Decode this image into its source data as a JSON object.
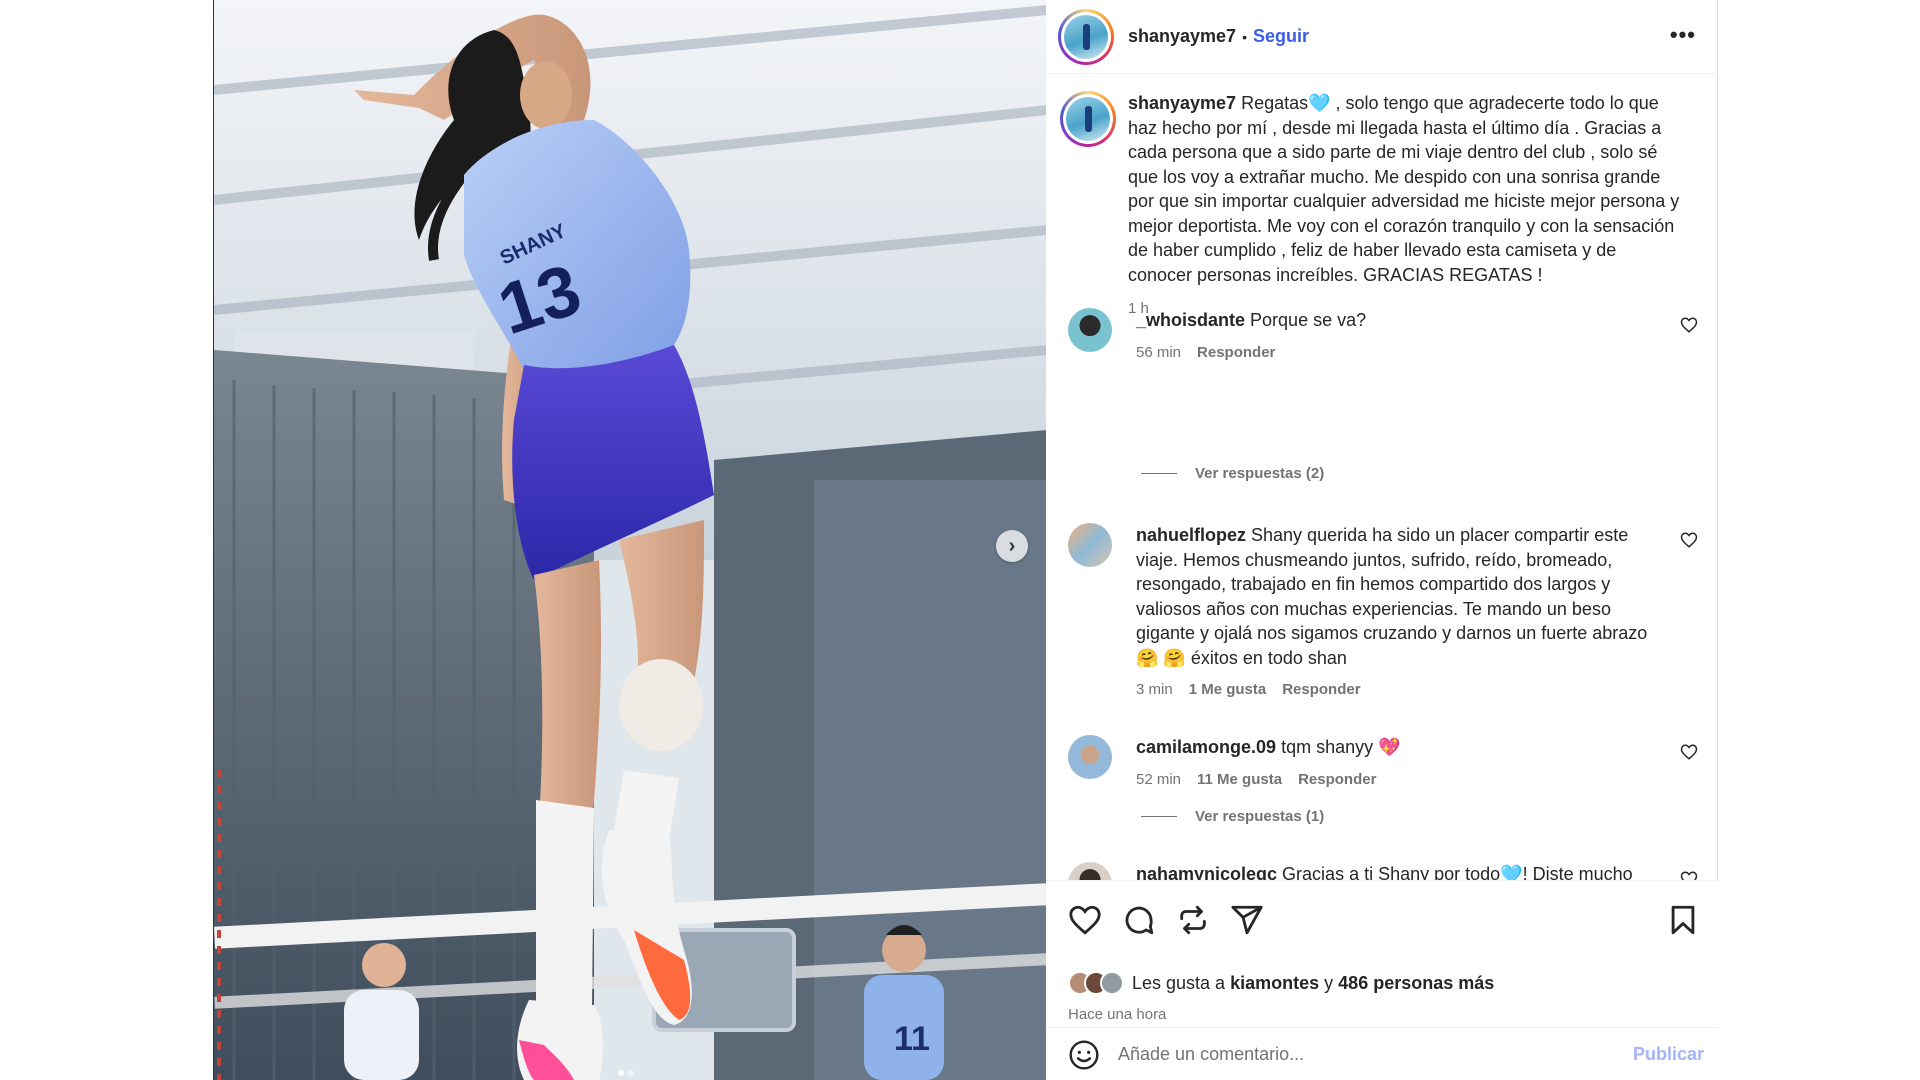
{
  "post": {
    "author": "shanyayme7",
    "follow_label": "Seguir",
    "separator": "•",
    "more_label": "•••",
    "caption": "Regatas🩵 , solo tengo que agradecerte todo lo que haz hecho por mí , desde mi llegada hasta el último día . Gracias a cada persona que a sido parte de mi viaje dentro del club , solo sé que los voy a extrañar mucho. Me despido con una sonrisa grande por que sin importar cualquier adversidad me hiciste mejor persona y mejor deportista. Me voy con el corazón tranquilo y con la sensación de haber cumplido , feliz de haber llevado esta camiseta y de conocer personas increíbles. GRACIAS REGATAS !",
    "caption_time": "1 h",
    "jersey_text": "SHANY",
    "jersey_number": "13",
    "carousel_next": "›",
    "carousel_position": 1,
    "carousel_count": 2
  },
  "comments": [
    {
      "username": "_whoisdante",
      "text": "Porque se va?",
      "time": "56 min",
      "likes": "",
      "reply": "Responder",
      "view_replies": "Ver respuestas (2)"
    },
    {
      "username": "nahuelflopez",
      "text": "Shany querida ha sido un placer compartir este viaje. Hemos chusmeando juntos, sufrido, reído, bromeado, resongado, trabajado en fin hemos compartido dos largos y valiosos años con muchas experiencias. Te mando un beso gigante y ojalá nos sigamos cruzando y darnos un fuerte abrazo 🤗 🤗 éxitos en todo shan",
      "time": "3 min",
      "likes": "1 Me gusta",
      "reply": "Responder",
      "view_replies": ""
    },
    {
      "username": "camilamonge.09",
      "text": "tqm shanyy 💖",
      "time": "52 min",
      "likes": "11 Me gusta",
      "reply": "Responder",
      "view_replies": "Ver respuestas (1)"
    },
    {
      "username": "nahamynicolegc",
      "text": "Gracias a ti Shany por todo🩵! Diste mucho",
      "time": "",
      "likes": "",
      "reply": "",
      "view_replies": ""
    }
  ],
  "likes_summary": {
    "prefix": "Les gusta a",
    "first_user": "kiamontes",
    "connector": "y",
    "others": "486 personas más"
  },
  "post_time": "Hace una hora",
  "comment_box": {
    "placeholder": "Añade un comentario...",
    "publish_label": "Publicar"
  },
  "colors": {
    "accent": "#3b5de7",
    "publish_disabled": "#a3b5f5",
    "secondary_text": "#737373"
  },
  "icons": [
    "heart-icon",
    "comment-icon",
    "repost-icon",
    "share-icon",
    "bookmark-icon",
    "emoji-icon",
    "more-icon",
    "chevron-right-icon"
  ]
}
